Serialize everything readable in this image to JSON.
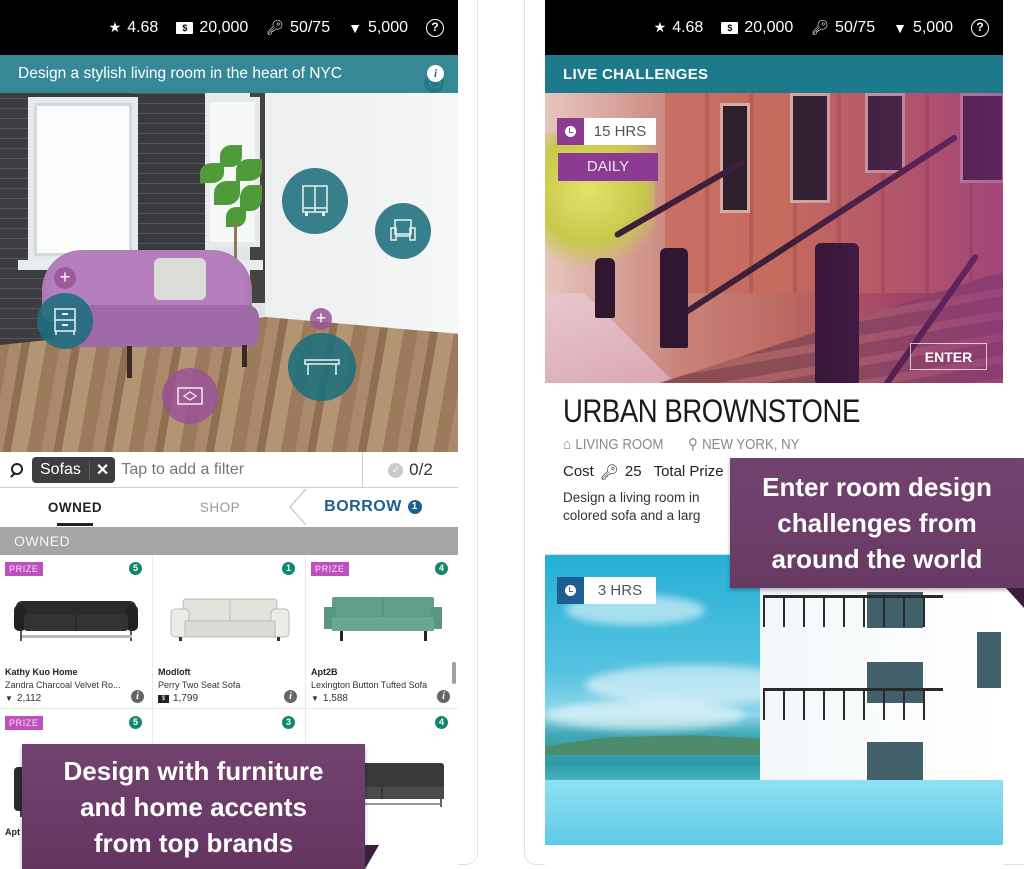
{
  "status_bar": {
    "rating": "4.68",
    "cash": "20,000",
    "cash_symbol": "$",
    "keys": "50/75",
    "diamonds": "5,000",
    "help": "?"
  },
  "left_screen": {
    "room_banner": "Design a stylish living room in the heart of NYC",
    "info_symbol": "i",
    "filter": {
      "active_chip": "Sofas",
      "chip_remove": "✕",
      "placeholder": "Tap to add a filter",
      "count": "0/2",
      "check_symbol": "✓"
    },
    "tabs": [
      {
        "label": "OWNED",
        "active": true
      },
      {
        "label": "SHOP",
        "active": false
      },
      {
        "label": "BORROW",
        "active": false,
        "badge": "1"
      }
    ],
    "section_title": "OWNED",
    "products": [
      {
        "prize": "PRIZE",
        "count": "5",
        "brand": "Kathy Kuo Home",
        "name": "Zandra Charcoal Velvet Ro...",
        "price": "2,112",
        "currency": "diamond",
        "color": "#2b2b2b"
      },
      {
        "prize": "",
        "count": "1",
        "brand": "Modloft",
        "name": "Perry Two Seat Sofa",
        "price": "1,799",
        "currency": "cash",
        "color": "#e3e1dc"
      },
      {
        "prize": "PRIZE",
        "count": "4",
        "brand": "Apt2B",
        "name": "Lexington Button Tufted Sofa",
        "price": "1,588",
        "currency": "diamond",
        "color": "#5f9e8a"
      },
      {
        "prize": "PRIZE",
        "count": "5",
        "brand": "Apt",
        "name": "",
        "price": "",
        "currency": "",
        "color": "#2b2b2b"
      },
      {
        "prize": "",
        "count": "3",
        "brand": "",
        "name": "",
        "price": "",
        "currency": "",
        "color": ""
      },
      {
        "prize": "",
        "count": "4",
        "brand": "",
        "name": "",
        "price": "",
        "currency": "",
        "color": "#3a3a3a"
      }
    ],
    "callout": [
      "Design with furniture",
      "and home accents",
      "from top brands"
    ]
  },
  "right_screen": {
    "header": "LIVE CHALLENGES",
    "challenge_1": {
      "timer": "15 HRS",
      "tag": "DAILY",
      "enter_label": "ENTER",
      "title": "URBAN BROWNSTONE",
      "room_type": "LIVING ROOM",
      "location": "NEW YORK, NY",
      "cost_label": "Cost",
      "cost_value": "25",
      "total_prize_label": "Total Prize",
      "description_line_1": "Design a living room in",
      "description_line_2": "colored sofa and a larg"
    },
    "challenge_2": {
      "timer": "3 HRS"
    },
    "callout": [
      "Enter room design",
      "challenges from",
      "around the world"
    ]
  },
  "colors": {
    "teal": "#1c7a8a",
    "purple_callout": "#6d3e69",
    "purple_tag": "#8c3b93",
    "prize_pink": "#c04fbf",
    "count_green": "#12866f",
    "borrow_blue": "#1f5f8f",
    "timer_blue": "#1f5f8f"
  }
}
